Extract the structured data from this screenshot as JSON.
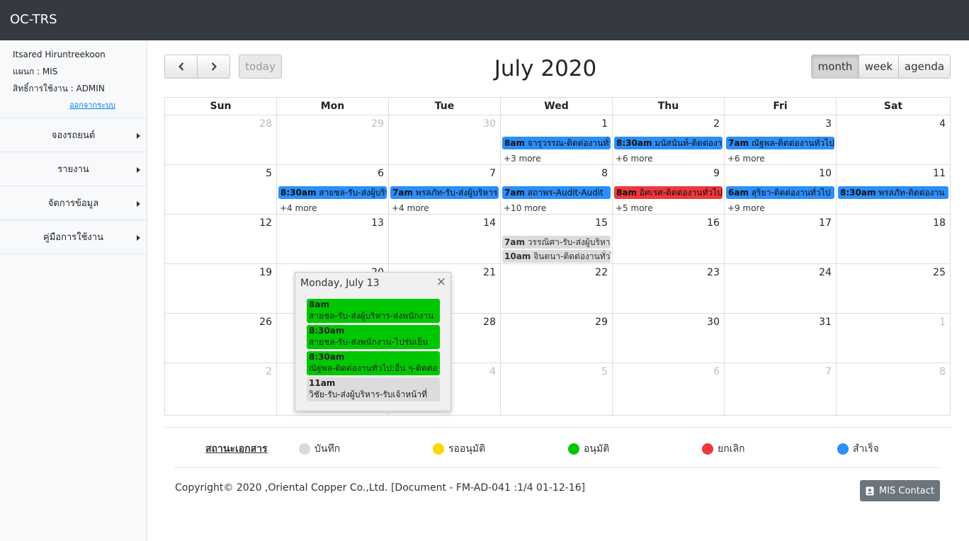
{
  "app": {
    "brand": "OC-TRS"
  },
  "user": {
    "name": "Itsared Hiruntreekoon",
    "department": "แผนก : MIS",
    "role": "สิทธิ์การใช้งาน : ADMIN",
    "logout": "ออกจากระบบ"
  },
  "menu": [
    {
      "label": "จองรถยนต์"
    },
    {
      "label": "รายงาน"
    },
    {
      "label": "จัดการข้อมูล"
    },
    {
      "label": "คู่มือการใช้งาน"
    }
  ],
  "toolbar": {
    "prev_icon": "chevron-left-icon",
    "next_icon": "chevron-right-icon",
    "today": "today",
    "title": "July 2020",
    "views": [
      {
        "label": "month",
        "active": true
      },
      {
        "label": "week",
        "active": false
      },
      {
        "label": "agenda",
        "active": false
      }
    ]
  },
  "calendar": {
    "weekdays": [
      "Sun",
      "Mon",
      "Tue",
      "Wed",
      "Thu",
      "Fri",
      "Sat"
    ],
    "weeks": [
      [
        {
          "d": "28",
          "other": true
        },
        {
          "d": "29",
          "other": true
        },
        {
          "d": "30",
          "other": true
        },
        {
          "d": "1",
          "events": [
            {
              "time": "8am",
              "title": "จารุวรรณ-ติดต่องานทั่วไป",
              "color": "#2c8ef8"
            }
          ],
          "more": "+3 more"
        },
        {
          "d": "2",
          "events": [
            {
              "time": "8:30am",
              "title": "มนัสนันท์-ติดต่องาน",
              "color": "#2c8ef8"
            }
          ],
          "more": "+6 more"
        },
        {
          "d": "3",
          "events": [
            {
              "time": "7am",
              "title": "ณัฐพล-ติดต่องานทั่วไป",
              "color": "#2c8ef8"
            }
          ],
          "more": "+6 more"
        },
        {
          "d": "4"
        }
      ],
      [
        {
          "d": "5"
        },
        {
          "d": "6",
          "events": [
            {
              "time": "8:30am",
              "title": "สายชล-รับ-ส่งผู้บริหาร",
              "color": "#2c8ef8"
            }
          ],
          "more": "+4 more"
        },
        {
          "d": "7",
          "events": [
            {
              "time": "7am",
              "title": "พรลภัท-รับ-ส่งผู้บริหาร",
              "color": "#2c8ef8"
            }
          ],
          "more": "+4 more"
        },
        {
          "d": "8",
          "events": [
            {
              "time": "7am",
              "title": "สถาพร-Audit-Audit",
              "color": "#2c8ef8"
            }
          ],
          "more": "+10 more"
        },
        {
          "d": "9",
          "events": [
            {
              "time": "8am",
              "title": "อิศเรศ-ติดต่องานทั่วไป",
              "color": "#f0383c"
            }
          ],
          "more": "+5 more"
        },
        {
          "d": "10",
          "events": [
            {
              "time": "6am",
              "title": "สุริยา-ติดต่องานทั่วไป",
              "color": "#2c8ef8"
            }
          ],
          "more": "+9 more"
        },
        {
          "d": "11",
          "events": [
            {
              "time": "8:30am",
              "title": "พรลภัท-ติดต่องาน",
              "color": "#2c8ef8"
            }
          ]
        }
      ],
      [
        {
          "d": "12"
        },
        {
          "d": "13"
        },
        {
          "d": "14"
        },
        {
          "d": "15",
          "events": [
            {
              "time": "7am",
              "title": "วรรณิศา-รับ-ส่งผู้บริหาร",
              "color": "#dcdcdc"
            },
            {
              "time": "10am",
              "title": "จินตนา-ติดต่องานทั่วไป",
              "color": "#dcdcdc"
            }
          ]
        },
        {
          "d": "16"
        },
        {
          "d": "17"
        },
        {
          "d": "18"
        }
      ],
      [
        {
          "d": "19"
        },
        {
          "d": "20"
        },
        {
          "d": "21"
        },
        {
          "d": "22"
        },
        {
          "d": "23"
        },
        {
          "d": "24"
        },
        {
          "d": "25"
        }
      ],
      [
        {
          "d": "26"
        },
        {
          "d": "27"
        },
        {
          "d": "28"
        },
        {
          "d": "29"
        },
        {
          "d": "30"
        },
        {
          "d": "31"
        },
        {
          "d": "1",
          "other": true
        }
      ],
      [
        {
          "d": "2",
          "other": true
        },
        {
          "d": "3",
          "other": true
        },
        {
          "d": "4",
          "other": true
        },
        {
          "d": "5",
          "other": true
        },
        {
          "d": "6",
          "other": true
        },
        {
          "d": "7",
          "other": true
        },
        {
          "d": "8",
          "other": true
        }
      ]
    ]
  },
  "popover": {
    "title": "Monday, July 13",
    "close": "×",
    "events": [
      {
        "time": "8am",
        "title": "สายชล-รับ-ส่งผู้บริหาร-ส่งพนักงาน",
        "color": "#00c800"
      },
      {
        "time": "8:30am",
        "title": "สายชล-รับ-ส่งพนักงาน-ไปร่มเย็น",
        "color": "#00c800"
      },
      {
        "time": "8:30am",
        "title": "ณัฐพล-ติดต่องานทั่วไป:อื่น ๆ-ติดต่อ",
        "color": "#00c800"
      },
      {
        "time": "11am",
        "title": "วิชัย-รับ-ส่งผู้บริหาร-รับเจ้าหน้าที่",
        "color": "#dcdcdc"
      }
    ]
  },
  "legend": {
    "title": "สถานะเอกสาร",
    "items": [
      {
        "label": "บันทึก",
        "color": "#d9d9d9"
      },
      {
        "label": "รออนุมัติ",
        "color": "#ffd700"
      },
      {
        "label": "อนุมัติ",
        "color": "#00c800"
      },
      {
        "label": "ยกเลิก",
        "color": "#f0383c"
      },
      {
        "label": "สำเร็จ",
        "color": "#2c8ef8"
      }
    ]
  },
  "footer": {
    "copyright": "Copyright© 2020 ,Oriental Copper Co.,Ltd. [Document - FM-AD-041 :1/4 01-12-16]",
    "contact": "MIS Contact",
    "contact_icon": "address-card-icon"
  }
}
